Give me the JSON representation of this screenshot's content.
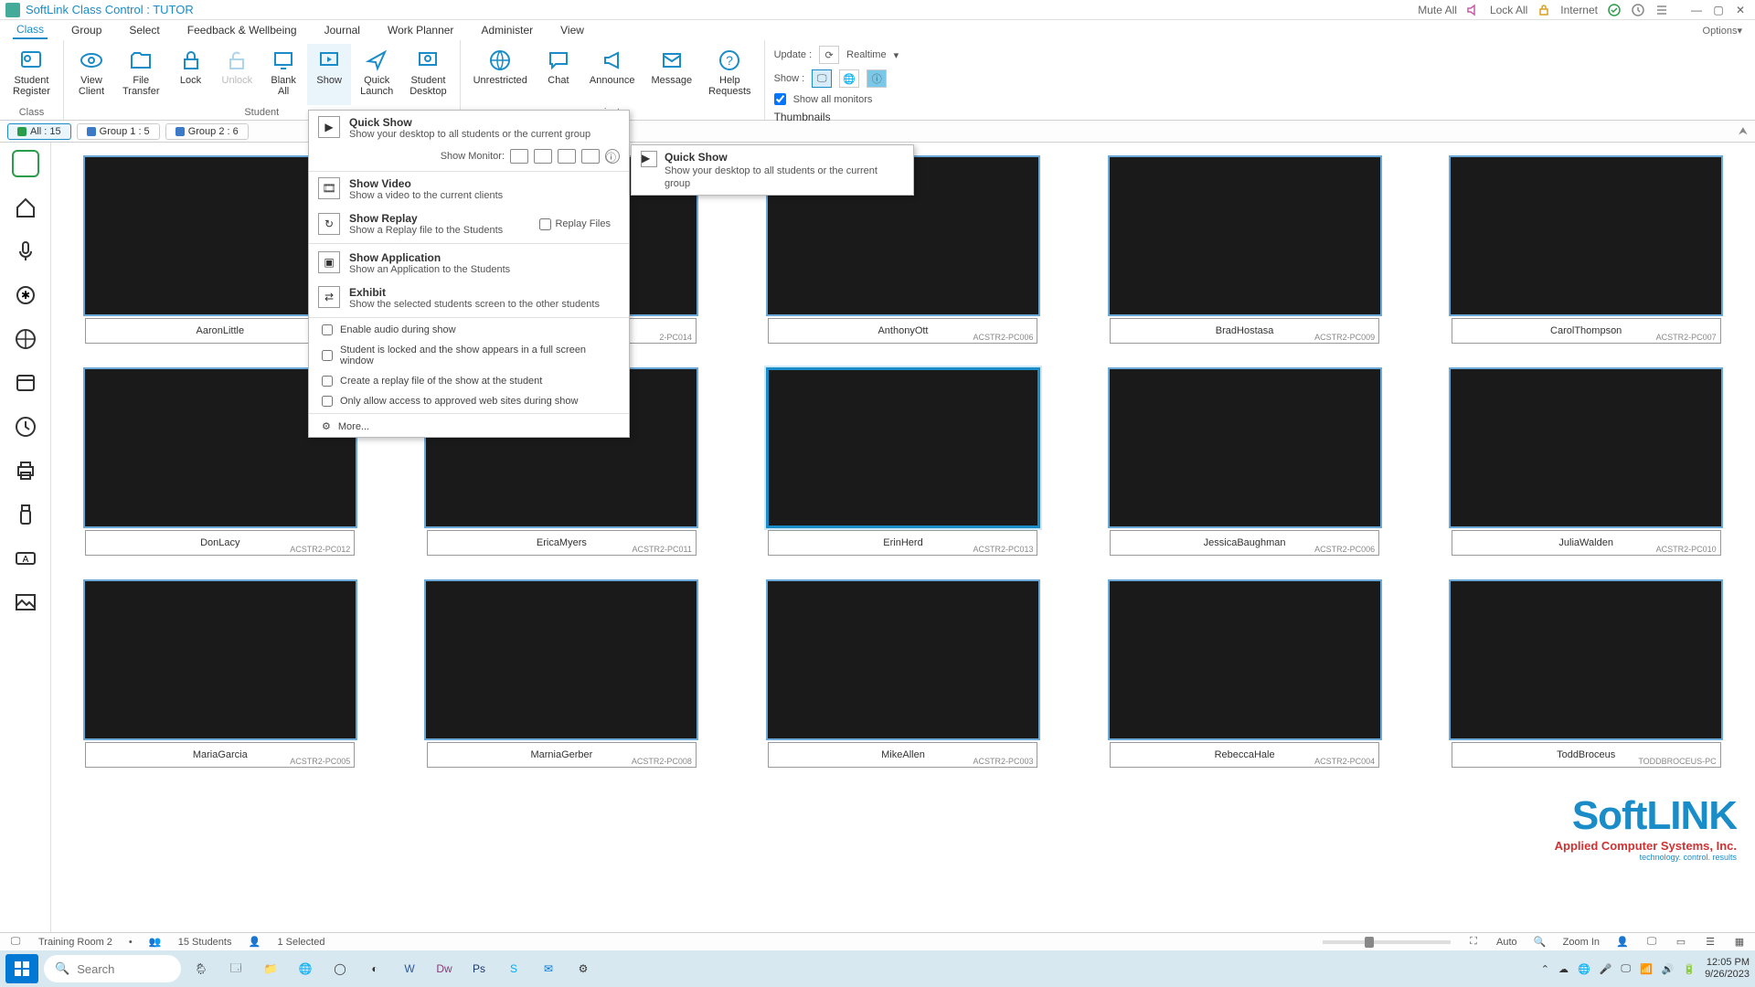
{
  "title": "SoftLink Class Control : TUTOR",
  "titlebar_right": {
    "mute": "Mute All",
    "lock": "Lock All",
    "internet": "Internet"
  },
  "menubar": [
    "Class",
    "Group",
    "Select",
    "Feedback & Wellbeing",
    "Journal",
    "Work Planner",
    "Administer",
    "View"
  ],
  "options_label": "Options",
  "ribbon": {
    "student_register": "Student\nRegister",
    "view_client": "View\nClient",
    "file_transfer": "File\nTransfer",
    "lock": "Lock",
    "unlock": "Unlock",
    "blank_all": "Blank\nAll",
    "show": "Show",
    "quick_launch": "Quick\nLaunch",
    "student_desktop": "Student\nDesktop",
    "unrestricted": "Unrestricted",
    "chat": "Chat",
    "announce": "Announce",
    "message": "Message",
    "help_requests": "Help\nRequests",
    "group_labels": {
      "class": "Class",
      "student": "Student",
      "communicate": "nicate",
      "thumbnails": "Thumbnails"
    },
    "update_label": "Update :",
    "update_value": "Realtime",
    "show_label": "Show :",
    "show_all_monitors": "Show all monitors"
  },
  "group_tabs": [
    {
      "label": "All : 15",
      "color": "#2a9d4a"
    },
    {
      "label": "Group 1 : 5",
      "color": "#3a7ac8"
    },
    {
      "label": "Group 2 : 6",
      "color": "#3a7ac8"
    }
  ],
  "dropdown": {
    "quick_show": {
      "title": "Quick Show",
      "desc": "Show your desktop to all students or the current group"
    },
    "show_monitor_label": "Show Monitor:",
    "show_video": {
      "title": "Show Video",
      "desc": "Show a video to the current clients"
    },
    "show_replay": {
      "title": "Show Replay",
      "desc": "Show a Replay file to the Students"
    },
    "replay_files": "Replay Files",
    "show_application": {
      "title": "Show Application",
      "desc": "Show an Application to the Students"
    },
    "exhibit": {
      "title": "Exhibit",
      "desc": "Show the selected students screen to the other students"
    },
    "check_audio": "Enable audio during show",
    "check_locked": "Student is locked and the show appears in a full screen window",
    "check_replay": "Create a replay file of the show at the student",
    "check_approved": "Only allow access to approved web sites during show",
    "more": "More..."
  },
  "tooltip": {
    "title": "Quick Show",
    "desc": "Show your desktop to all students or the current group"
  },
  "students": [
    {
      "name": "AaronLittle",
      "pc": "",
      "land": "land1"
    },
    {
      "name": "",
      "pc": "2-PC014",
      "land": "land2"
    },
    {
      "name": "AnthonyOtt",
      "pc": "ACSTR2-PC006",
      "land": "land3"
    },
    {
      "name": "BradHostasa",
      "pc": "ACSTR2-PC009",
      "land": "land3"
    },
    {
      "name": "CarolThompson",
      "pc": "ACSTR2-PC007",
      "land": "land4"
    },
    {
      "name": "DonLacy",
      "pc": "ACSTR2-PC012",
      "land": "land5"
    },
    {
      "name": "EricaMyers",
      "pc": "ACSTR2-PC011",
      "land": "land6"
    },
    {
      "name": "ErinHerd",
      "pc": "ACSTR2-PC013",
      "land": "land7"
    },
    {
      "name": "JessicaBaughman",
      "pc": "ACSTR2-PC006",
      "land": "land8"
    },
    {
      "name": "JuliaWalden",
      "pc": "ACSTR2-PC010",
      "land": "land9"
    },
    {
      "name": "MariaGarcia",
      "pc": "ACSTR2-PC005",
      "land": "land10"
    },
    {
      "name": "MarniaGerber",
      "pc": "ACSTR2-PC008",
      "land": "land11"
    },
    {
      "name": "MikeAllen",
      "pc": "ACSTR2-PC003",
      "land": "land12"
    },
    {
      "name": "RebeccaHale",
      "pc": "ACSTR2-PC004",
      "land": "land13"
    },
    {
      "name": "ToddBroceus",
      "pc": "TODDBROCEUS-PC",
      "land": "land14"
    }
  ],
  "logo": {
    "big": "SoftLINK",
    "sub": "Applied Computer Systems, Inc.",
    "sub2": "technology. control. results"
  },
  "statusbar": {
    "room": "Training Room 2",
    "students": "15 Students",
    "selected": "1 Selected",
    "auto": "Auto",
    "zoom": "Zoom In"
  },
  "taskbar": {
    "search": "Search",
    "time": "12:05 PM",
    "date": "9/26/2023"
  }
}
